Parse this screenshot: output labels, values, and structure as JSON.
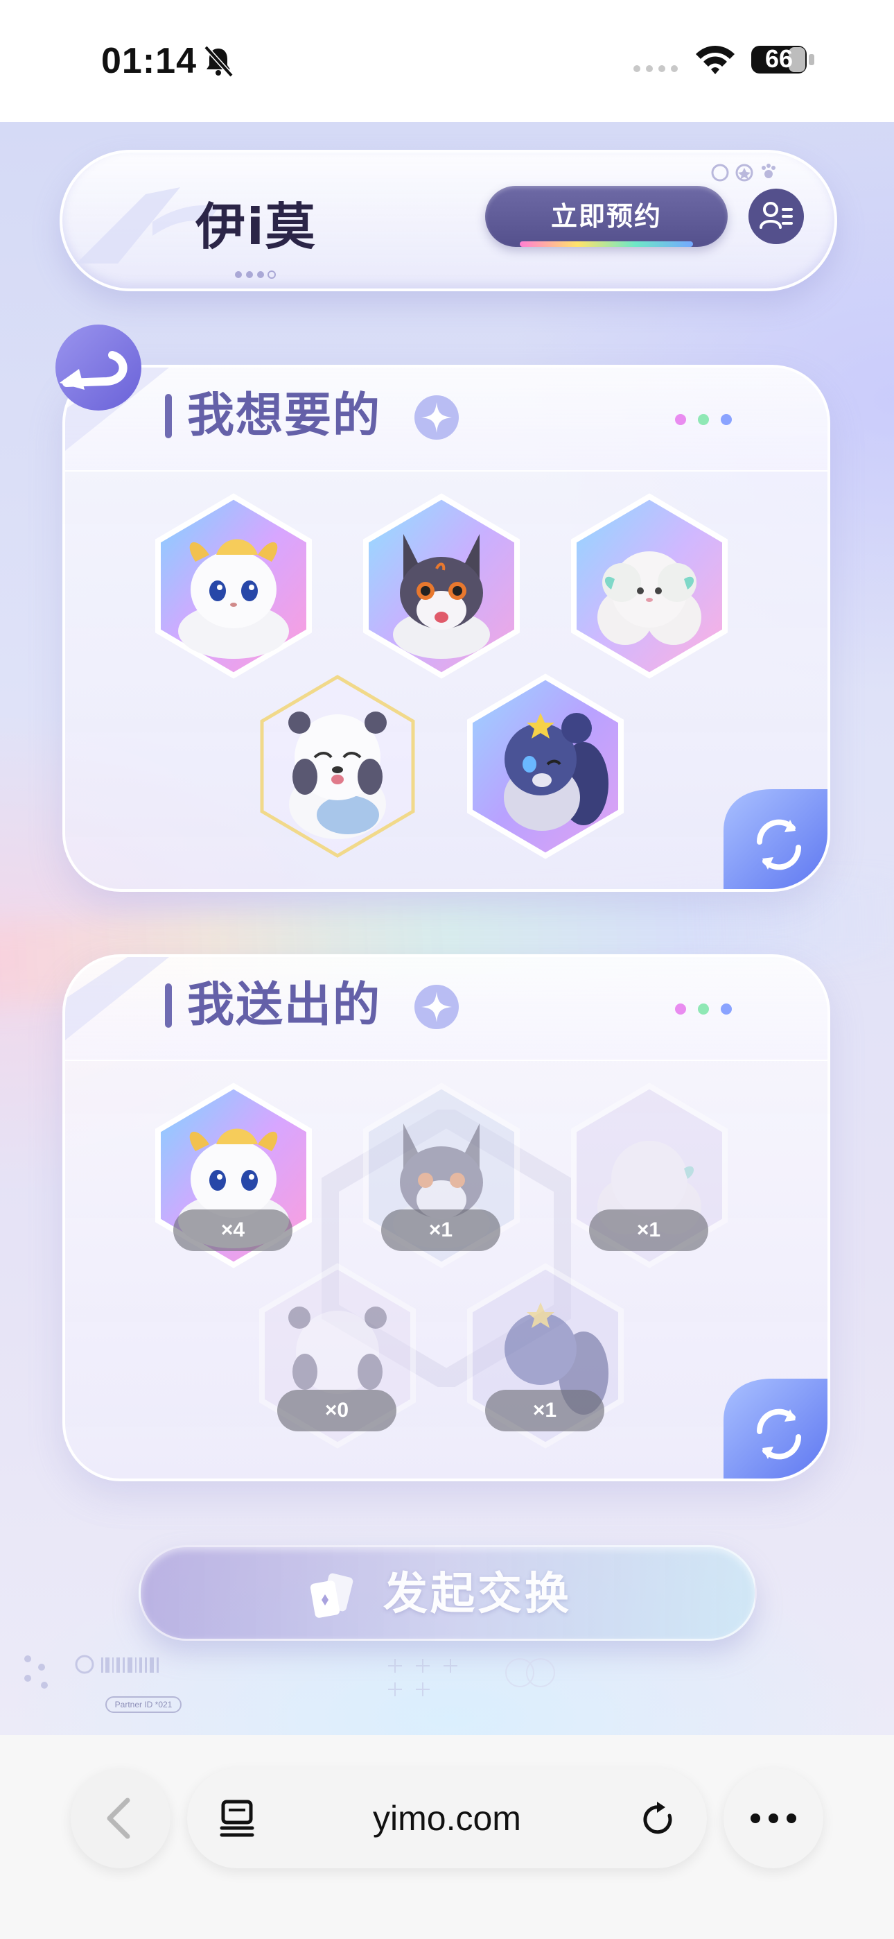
{
  "status_bar": {
    "time": "01:14",
    "battery": "66"
  },
  "header": {
    "logo": "伊i莫",
    "reserve_label": "立即预约"
  },
  "want_section": {
    "title": "我想要的",
    "items": [
      {
        "name": "Cream fox-cat",
        "icon": "creature-cream-fox"
      },
      {
        "name": "Gray wolf pup",
        "icon": "creature-gray-wolf"
      },
      {
        "name": "Fluffy sheep",
        "icon": "creature-fluffy-sheep"
      },
      {
        "name": "White bear",
        "icon": "creature-white-bear"
      },
      {
        "name": "Blue star squirrel",
        "icon": "creature-blue-squirrel"
      }
    ]
  },
  "give_section": {
    "title": "我送出的",
    "items": [
      {
        "icon": "creature-cream-fox",
        "count": "×4",
        "available": true
      },
      {
        "icon": "creature-gray-wolf",
        "count": "×1",
        "available": false
      },
      {
        "icon": "creature-fluffy-sheep",
        "count": "×1",
        "available": false
      },
      {
        "icon": "creature-white-bear",
        "count": "×0",
        "available": false
      },
      {
        "icon": "creature-blue-squirrel",
        "count": "×1",
        "available": false
      }
    ]
  },
  "exchange_button": {
    "label": "发起交换"
  },
  "footer": {
    "partner_id": "Partner ID *021"
  },
  "browser": {
    "url": "yimo.com"
  },
  "colors": {
    "accent": "#6460a8",
    "button_dark": "#54508c"
  }
}
